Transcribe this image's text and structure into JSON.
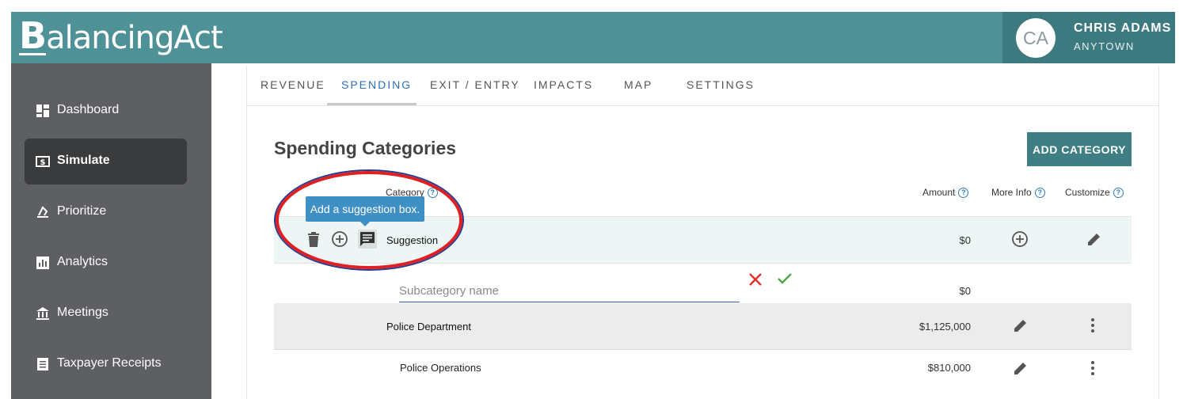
{
  "header": {
    "logo_initial": "B",
    "logo_rest": "alancingAct",
    "user_initials": "CA",
    "user_name": "CHRIS ADAMS",
    "user_location": "ANYTOWN"
  },
  "sidebar": {
    "items": [
      {
        "label": "Dashboard",
        "icon": "dashboard-icon"
      },
      {
        "label": "Simulate",
        "icon": "dollar-icon",
        "active": true
      },
      {
        "label": "Prioritize",
        "icon": "scale-icon"
      },
      {
        "label": "Analytics",
        "icon": "bar-chart-icon"
      },
      {
        "label": "Meetings",
        "icon": "building-icon"
      },
      {
        "label": "Taxpayer Receipts",
        "icon": "receipt-icon"
      }
    ]
  },
  "tabs": [
    {
      "label": "REVENUE"
    },
    {
      "label": "SPENDING",
      "active": true
    },
    {
      "label": "EXIT / ENTRY"
    },
    {
      "label": "IMPACTS"
    },
    {
      "label": "MAP"
    },
    {
      "label": "SETTINGS"
    }
  ],
  "main": {
    "title": "Spending Categories",
    "add_button": "ADD CATEGORY",
    "columns": {
      "category": "Category",
      "amount": "Amount",
      "more_info": "More Info",
      "customize": "Customize"
    },
    "tooltip": "Add a suggestion box.",
    "rows": {
      "suggestion": {
        "label": "Suggestion",
        "amount": "$0"
      },
      "new_sub": {
        "placeholder": "Subcategory name",
        "amount": "$0"
      },
      "police": {
        "label": "Police Department",
        "amount": "$1,125,000"
      },
      "police_ops": {
        "label": "Police Operations",
        "amount": "$810,000"
      }
    }
  },
  "colors": {
    "header": "#4e9196",
    "sidebar": "#5e5f62",
    "accent": "#3f7f84",
    "tab_active": "#2f6fb2",
    "annotation": "#e02020"
  }
}
